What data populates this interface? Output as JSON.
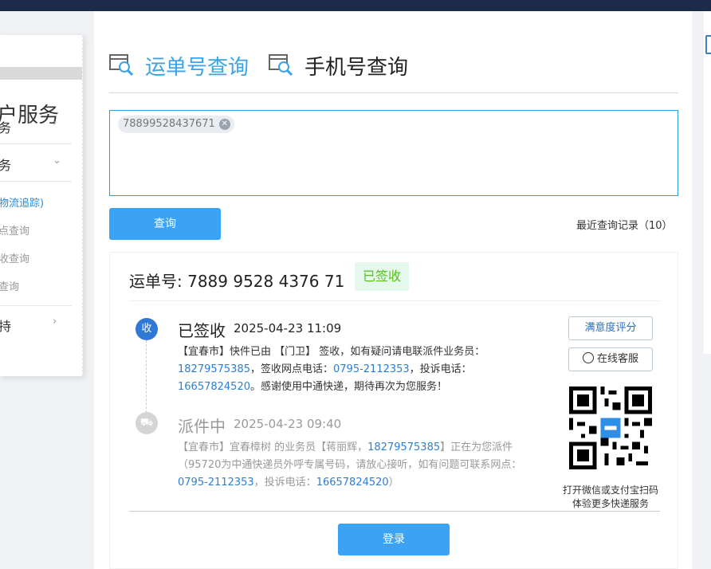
{
  "sidebar": {
    "title": "户服务",
    "items": [
      {
        "label": "务",
        "chevron": "›"
      },
      {
        "label": "务",
        "chevron": "⌄"
      },
      {
        "label": "持",
        "chevron": "›"
      }
    ],
    "sub_items": [
      {
        "label": "物流追踪)",
        "active": true
      },
      {
        "label": "点查询",
        "active": false
      },
      {
        "label": "收查询",
        "active": false
      },
      {
        "label": "查询",
        "active": false
      }
    ]
  },
  "tabs": [
    {
      "label": "运单号查询",
      "active": true,
      "icon": "package-search-icon"
    },
    {
      "label": "手机号查询",
      "active": false,
      "icon": "package-search-icon"
    }
  ],
  "query": {
    "tracking_chip": "78899528437671",
    "chip_remove": "✕",
    "button_label": "查询",
    "recent_label": "最近查询记录（10）"
  },
  "result": {
    "waybill_label": "运单号: 7889 9528 4376 71",
    "status_badge": "已签收",
    "events": [
      {
        "dot": "收",
        "status": "已签收",
        "time": "2025-04-23 11:09",
        "detail_1": "【宜春市】快件已由 【门卫】 签收，如有疑问请电联派件业务员：",
        "phone_1": "18279575385",
        "detail_2": "，签收网点电话：",
        "phone_2": "0795-2112353",
        "detail_3": "，投诉电话：",
        "phone_3": "16657824520",
        "detail_4": "。感谢使用中通快递，期待再次为您服务！"
      },
      {
        "dot": "⛟",
        "status": "派件中",
        "time": "2025-04-23 09:40",
        "detail_1": "【宜春市】宜春樟树 的业务员【蒋丽辉，",
        "phone_1": "18279575385",
        "detail_2": "】正在为您派件（95720为中通快递员外呼专属号码，请放心接听，如有问题可联系网点：",
        "phone_2": "0795-2112353",
        "detail_3": "，投诉电话：",
        "phone_3": "16657824520",
        "detail_4": "）"
      }
    ],
    "rating_button": "满意度评分",
    "service_button": "在线客服",
    "qr_caption_1": "打开微信或支付宝扫码",
    "qr_caption_2": "体验更多快递服务",
    "login_button": "登录"
  },
  "colors": {
    "accent": "#3aa3f5",
    "link": "#2a7fd4",
    "signed_green": "#52c41a",
    "topbar": "#1c2b4a"
  }
}
